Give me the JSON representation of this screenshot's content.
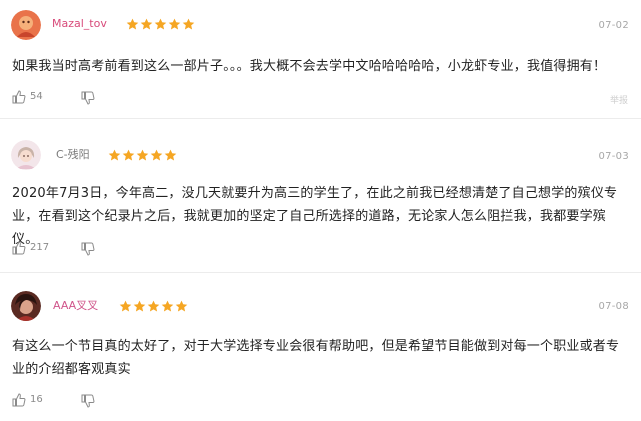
{
  "colors": {
    "star": "#f5a623",
    "username_1": "#d84a7a",
    "username_2": "#7a7a7a",
    "username_3": "#d0548a",
    "date": "#a7a7a7",
    "divider": "#ececec"
  },
  "comments": [
    {
      "username": "Mazal_tov",
      "rating": 5,
      "date": "07-02",
      "text": "如果我当时高考前看到这么一部片子。。。我大概不会去学中文哈哈哈哈哈，小龙虾专业，我值得拥有！",
      "likes": "54",
      "report": "举报"
    },
    {
      "username": "C-残阳",
      "rating": 5,
      "date": "07-03",
      "text": "2020年7月3日，今年高二，没几天就要升为高三的学生了，在此之前我已经想清楚了自己想学的殡仪专业，在看到这个纪录片之后，我就更加的坚定了自己所选择的道路，无论家人怎么阻拦我，我都要学殡仪。",
      "likes": "217"
    },
    {
      "username": "AAA叉叉",
      "rating": 5,
      "date": "07-08",
      "text": "有这么一个节目真的太好了，对于大学选择专业会很有帮助吧，但是希望节目能做到对每一个职业或者专业的介绍都客观真实",
      "likes": "16"
    }
  ]
}
